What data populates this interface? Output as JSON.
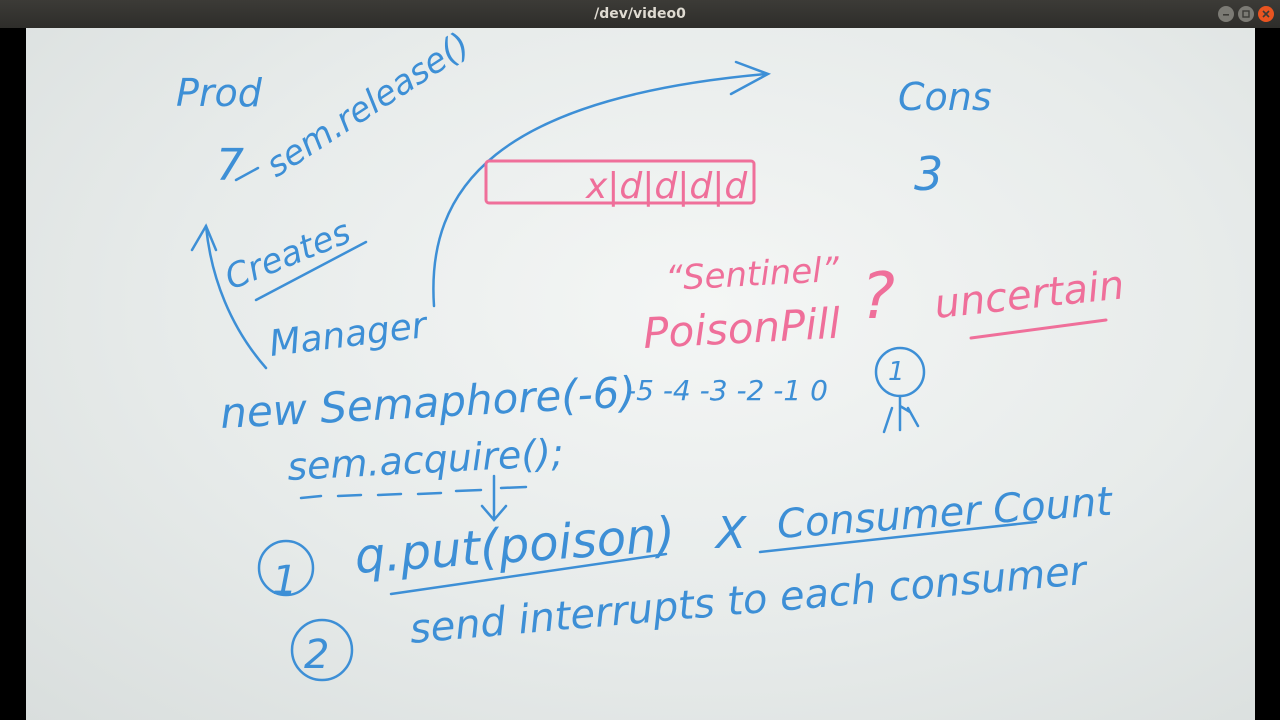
{
  "window": {
    "title": "/dev/video0",
    "buttons": {
      "minimize": "minimize-icon",
      "maximize": "maximize-icon",
      "close": "close-icon"
    }
  },
  "colors": {
    "blue_ink": "#3d8fd6",
    "pink_ink": "#ef6f9a",
    "titlebar": "#33322e",
    "close": "#e95420"
  },
  "whiteboard": {
    "prod": "Prod",
    "prod_count": "7",
    "sem_release": "sem.release()",
    "creates": "Creates",
    "manager": "Manager",
    "cons": "Cons",
    "cons_count": "3",
    "queue_contents": "x|d|d|d|d",
    "sentinel": "“Sentinel”",
    "poison_pill": "PoisonPill",
    "question": "?",
    "uncertain": "uncertain",
    "new_semaphore": "new Semaphore(-6)",
    "count_sequence": "-5 -4 -3 -2 -1 0",
    "circled_one_small": "1",
    "sem_acquire": "sem.acquire();",
    "option1_number": "1",
    "option1_text": "q.put(poison)",
    "times": "X",
    "consumer_count": "Consumer Count",
    "option2_number": "2",
    "option2_text": "send interrupts to each consumer"
  }
}
